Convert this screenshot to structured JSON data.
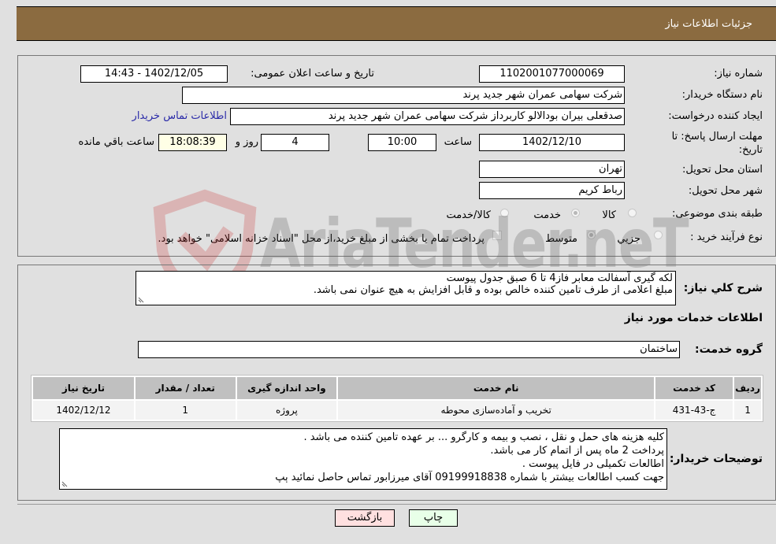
{
  "header": {
    "title": "جزئیات اطلاعات نیاز"
  },
  "form": {
    "need_number": {
      "label": "شماره نیاز:",
      "value": "1102001077000069"
    },
    "announce_datetime": {
      "label": "تاریخ و ساعت اعلان عمومی:",
      "value": "1402/12/05 - 14:43"
    },
    "buyer_org": {
      "label": "نام دستگاه خریدار:",
      "value": "شرکت سهامی عمران شهر جدید پرند"
    },
    "requester": {
      "label": "ایجاد کننده درخواست:",
      "value": "صدقعلی بیران بودالالو کاربرداز شرکت سهامی عمران شهر جدید پرند"
    },
    "buyer_contact_link": "اطلاعات تماس خریدار",
    "deadline": {
      "label_line1": "مهلت ارسال پاسخ: تا",
      "label_line2": "تاریخ:",
      "date": "1402/12/10",
      "time_label": "ساعت",
      "time": "10:00",
      "days": "4",
      "days_label": "روز و",
      "remaining": "18:08:39",
      "remaining_label": "ساعت باقي مانده"
    },
    "province": {
      "label": "استان محل تحویل:",
      "value": "تهران"
    },
    "city": {
      "label": "شهر محل تحویل:",
      "value": "رباط کریم"
    },
    "category": {
      "label": "طبقه بندی موضوعی:",
      "options": [
        "کالا",
        "خدمت",
        "کالا/خدمت"
      ],
      "selected": "خدمت"
    },
    "purchase_type": {
      "label": "نوع فرآیند خرید :",
      "options": [
        "جزيي",
        "متوسط"
      ],
      "selected": "متوسط",
      "treasury_checkbox_label": "پرداخت تمام یا بخشی از مبلغ خرید،از محل \"اسناد خزانه اسلامی\" خواهد بود.",
      "treasury_checked": false
    }
  },
  "description": {
    "label": "شرح کلي نیاز:",
    "lines": [
      "لکه گیری آسفالت معابر فاز4 تا 6 صبق جدول پیوست",
      "مبلغ اعلامی از طرف تامین کننده خالص بوده و قابل افزایش به هیچ عنوان نمی باشد."
    ]
  },
  "services": {
    "section_title": "اطلاعات خدمات مورد نیاز",
    "group_label": "گروه خدمت:",
    "group_value": "ساختمان",
    "columns": [
      "ردیف",
      "کد خدمت",
      "نام خدمت",
      "واحد اندازه گیری",
      "تعداد / مقدار",
      "تاریخ نیاز"
    ],
    "rows": [
      [
        "1",
        "ج-43-431",
        "تخریب و آماده‌سازی محوطه",
        "پروژه",
        "1",
        "1402/12/12"
      ]
    ]
  },
  "buyer_notes": {
    "label": "توضیحات خریدار:",
    "lines": [
      "کلیه هزینه های حمل و نقل ، نصب و بیمه و کارگرو ... بر عهده تامین کننده می باشد .",
      "پرداخت 2 ماه پس از اتمام کار می باشد.",
      "اطالعات تکمیلی در فایل پیوست .",
      "جهت کسب اطالعات بیشتر با شماره 09199918838 آقای میرزابور تماس حاصل نمائید ٻپ"
    ]
  },
  "buttons": {
    "print": "چاپ",
    "back": "بازگشت"
  },
  "watermark": "AriaTender.neT"
}
